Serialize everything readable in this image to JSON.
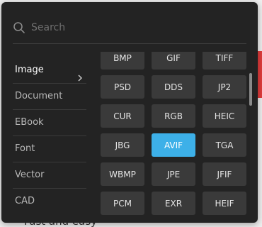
{
  "background": {
    "underlay_text": "Fast and easy"
  },
  "search": {
    "placeholder": "Search",
    "value": "",
    "icon": "search-icon"
  },
  "categories": [
    {
      "label": "Image",
      "active": true,
      "icon": "chevron-right-icon"
    },
    {
      "label": "Document",
      "active": false
    },
    {
      "label": "EBook",
      "active": false
    },
    {
      "label": "Font",
      "active": false
    },
    {
      "label": "Vector",
      "active": false
    },
    {
      "label": "CAD",
      "active": false
    }
  ],
  "formats": [
    {
      "label": "BMP",
      "selected": false
    },
    {
      "label": "GIF",
      "selected": false
    },
    {
      "label": "TIFF",
      "selected": false
    },
    {
      "label": "PSD",
      "selected": false
    },
    {
      "label": "DDS",
      "selected": false
    },
    {
      "label": "JP2",
      "selected": false
    },
    {
      "label": "CUR",
      "selected": false
    },
    {
      "label": "RGB",
      "selected": false
    },
    {
      "label": "HEIC",
      "selected": false
    },
    {
      "label": "JBG",
      "selected": false
    },
    {
      "label": "AVIF",
      "selected": true
    },
    {
      "label": "TGA",
      "selected": false
    },
    {
      "label": "WBMP",
      "selected": false
    },
    {
      "label": "JPE",
      "selected": false
    },
    {
      "label": "JFIF",
      "selected": false
    },
    {
      "label": "PCM",
      "selected": false
    },
    {
      "label": "EXR",
      "selected": false
    },
    {
      "label": "HEIF",
      "selected": false
    }
  ],
  "colors": {
    "popup_bg": "#232323",
    "button_bg": "#3a3a3a",
    "accent": "#3db0e8",
    "side_accent": "#e23c3c"
  }
}
